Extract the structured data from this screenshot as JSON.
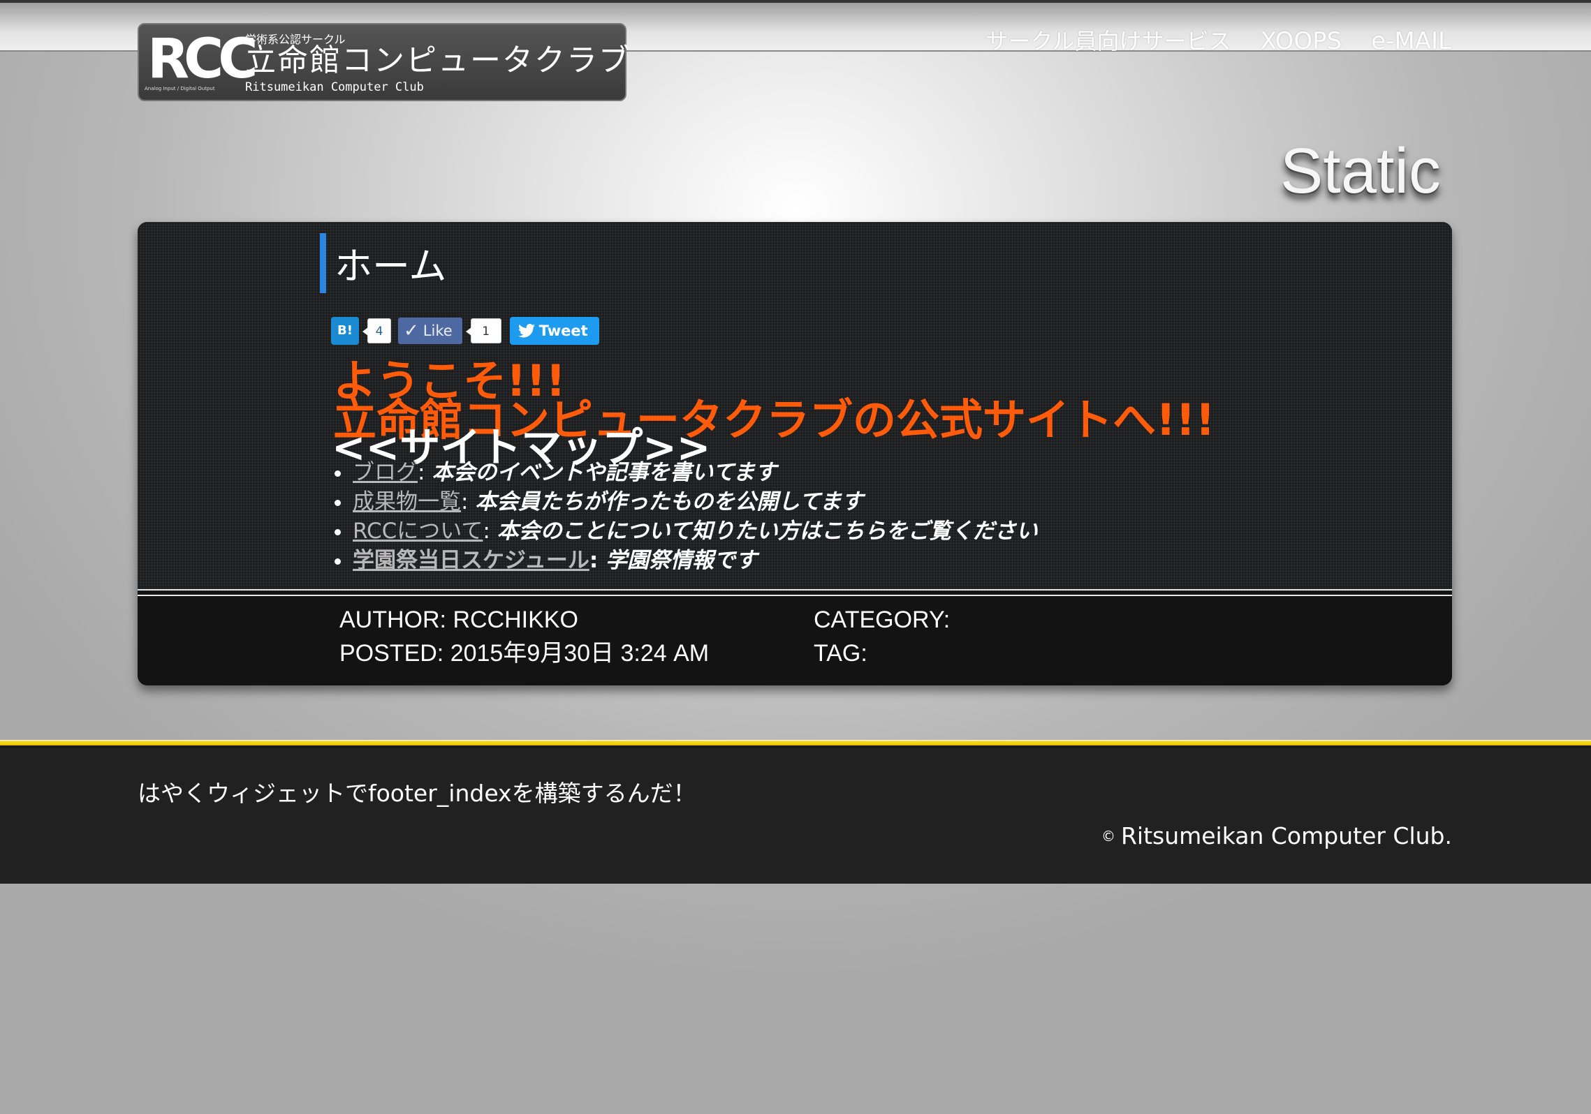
{
  "header": {
    "logo": {
      "mark": "RCC",
      "mark_sub": "Analog Input / Digital Output",
      "small": "学術系公認サークル",
      "main": "立命館コンピュータクラブ",
      "english": "Ritsumeikan Computer Club"
    },
    "nav": [
      {
        "label": "サークル員向けサービス"
      },
      {
        "label": "XOOPS"
      },
      {
        "label": "e-MAIL"
      }
    ]
  },
  "banner": {
    "title": "Static"
  },
  "post": {
    "heading": "ホーム",
    "social": {
      "hatena_label": "B!",
      "hatena_count": "4",
      "like_label": "Like",
      "like_count": "1",
      "tweet_label": "Tweet"
    },
    "welcome_line1": "ようこそ!!!",
    "welcome_line2": "立命館コンピュータクラブの公式サイトへ!!!",
    "sitemap_title": "<<サイトマップ>>",
    "links": [
      {
        "label": "ブログ",
        "desc": "本会のイベントや記事を書いてます",
        "bold": false
      },
      {
        "label": "成果物一覧",
        "desc": "本会員たちが作ったものを公開してます",
        "bold": false
      },
      {
        "label": "RCCについて",
        "desc": "本会のことについて知りたい方はこちらをご覧ください",
        "bold": false
      },
      {
        "label": "学園祭当日スケジュール",
        "desc": "学園祭情報です",
        "bold": true
      }
    ],
    "meta": {
      "author": "AUTHOR: RCCHIKKO",
      "posted": "POSTED: 2015年9月30日 3:24 AM",
      "category": "CATEGORY:",
      "tag": "TAG:"
    }
  },
  "footer": {
    "message": "はやくウィジェットでfooter_indexを構築するんだ！",
    "copyright_symbol": "©",
    "copyright": "Ritsumeikan Computer Club."
  },
  "colors": {
    "accent_blue": "#2a86e0",
    "welcome_orange": "#ff5b0a",
    "footer_stripe": "#e8c400"
  }
}
